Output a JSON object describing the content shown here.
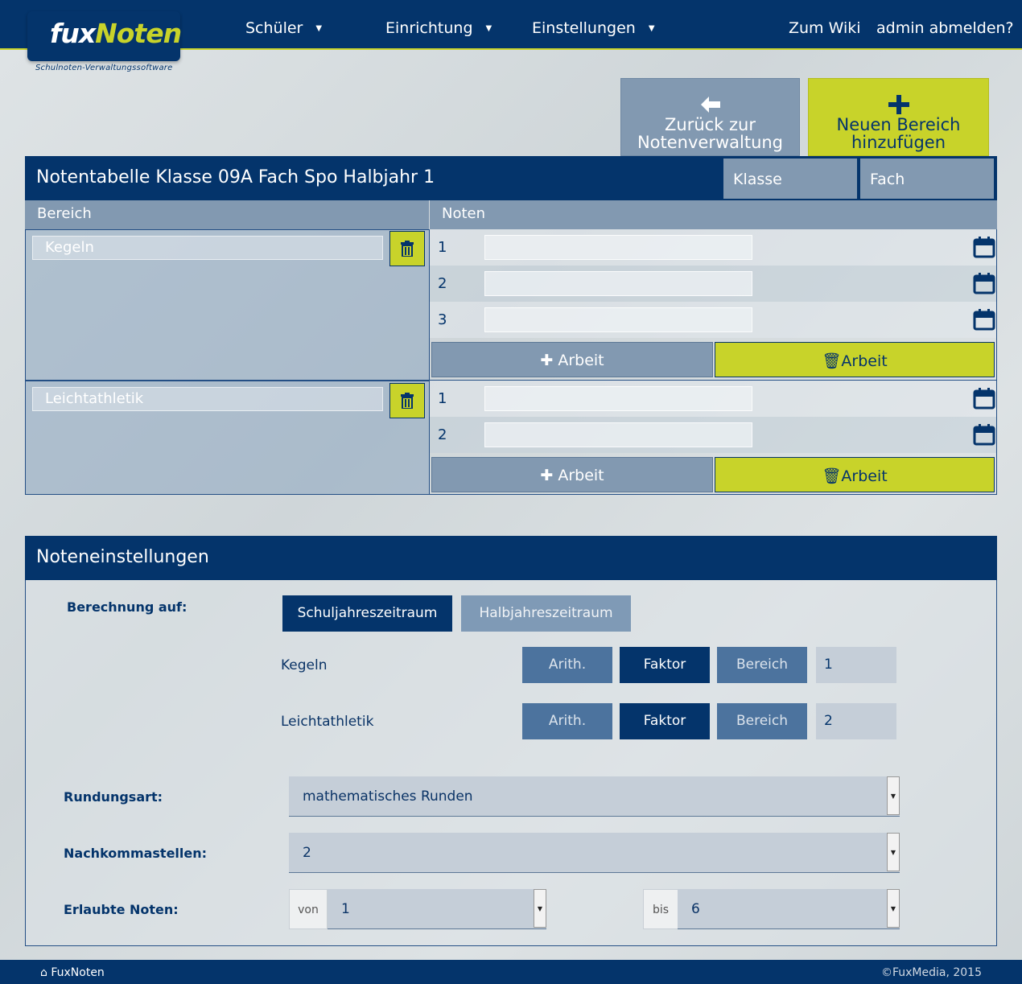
{
  "brand": {
    "name_part1": "fux",
    "name_part2": "Noten",
    "tagline": "Schulnoten-Verwaltungssoftware"
  },
  "nav": {
    "items": [
      {
        "label": "Schüler",
        "has_caret": true
      },
      {
        "label": "Einrichtung",
        "has_caret": true
      },
      {
        "label": "Einstellungen",
        "has_caret": true
      }
    ],
    "wiki": "Zum Wiki",
    "logout": "admin abmelden?"
  },
  "actions": {
    "back_line1": "Zurück zur",
    "back_line2": "Notenverwaltung",
    "add_line1": "Neuen Bereich",
    "add_line2": "hinzufügen"
  },
  "table": {
    "title": "Notentabelle Klasse 09A Fach Spo Halbjahr 1",
    "btn_klasse": "Klasse",
    "btn_fach": "Fach",
    "col_area": "Bereich",
    "col_notes": "Noten",
    "add_work": "Arbeit",
    "del_work": "Arbeit",
    "areas": [
      {
        "name": "Kegeln",
        "notes": [
          "1",
          "2",
          "3"
        ]
      },
      {
        "name": "Leichtathletik",
        "notes": [
          "1",
          "2"
        ]
      }
    ]
  },
  "settings": {
    "title": "Noteneinstellungen",
    "calc_label": "Berechnung auf:",
    "calc_year": "Schuljahreszeitraum",
    "calc_half": "Halbjahreszeitraum",
    "weights": [
      {
        "area": "Kegeln",
        "arith": "Arith.",
        "faktor": "Faktor",
        "bereich": "Bereich",
        "value": "1"
      },
      {
        "area": "Leichtathletik",
        "arith": "Arith.",
        "faktor": "Faktor",
        "bereich": "Bereich",
        "value": "2"
      }
    ],
    "rounding_label": "Rundungsart:",
    "rounding_value": "mathematisches Runden",
    "decimals_label": "Nachkommastellen:",
    "decimals_value": "2",
    "allowed_label": "Erlaubte Noten:",
    "from_addon": "von",
    "from_value": "1",
    "to_addon": "bis",
    "to_value": "6"
  },
  "footer": {
    "home": "FuxNoten",
    "copyright": "©FuxMedia, 2015"
  },
  "colors": {
    "navy": "#04346b",
    "lime": "#c8d32a",
    "steel": "#8299b1"
  }
}
